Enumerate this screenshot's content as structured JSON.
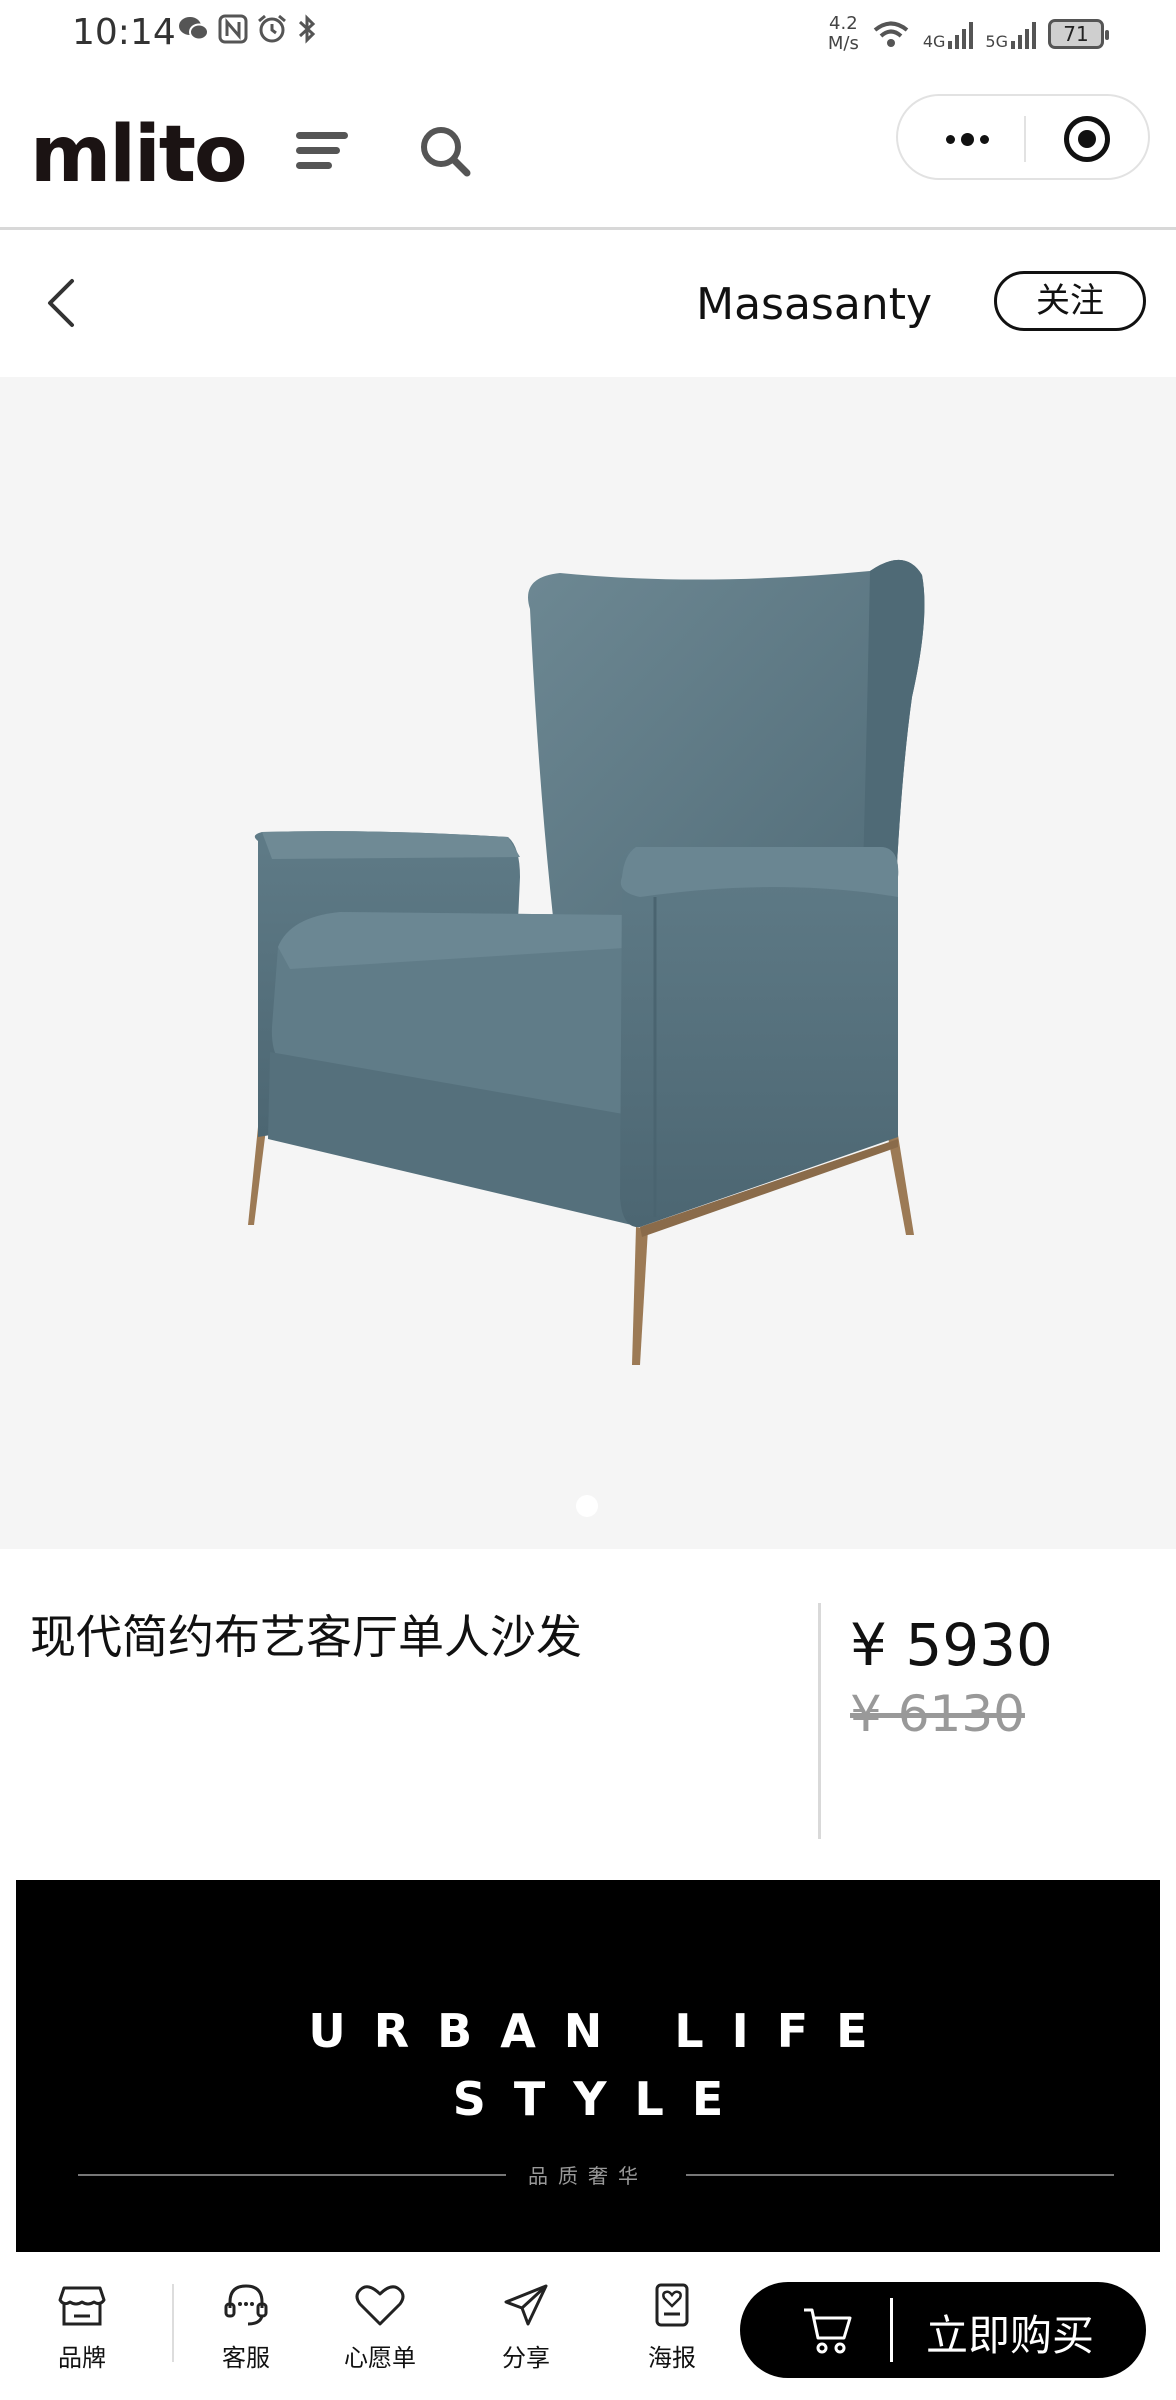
{
  "status_bar": {
    "time": "10:14",
    "net_speed_value": "4.2",
    "net_speed_unit": "M/s",
    "battery": "71",
    "signal_label_1": "4G",
    "signal_label_2": "5G"
  },
  "header": {
    "logo": "mlito"
  },
  "brand": {
    "name": "Masasanty",
    "follow_label": "关注"
  },
  "product": {
    "title": "现代简约布艺客厅单人沙发",
    "price": "¥ 5930",
    "original_price": "¥ 6130",
    "image_count": 1,
    "active_image_index": 1
  },
  "banner": {
    "line1": "URBAN LIFE",
    "line2": "STYLE",
    "tagline": "品质奢华"
  },
  "bottom_bar": {
    "brand_label": "品牌",
    "service_label": "客服",
    "wishlist_label": "心愿单",
    "share_label": "分享",
    "poster_label": "海报",
    "buy_label": "立即购买"
  },
  "colors": {
    "sofa_fabric": "#5f7b87",
    "sofa_legs": "#9c7a55",
    "image_bg": "#f5f5f5",
    "banner_bg": "#000000"
  }
}
